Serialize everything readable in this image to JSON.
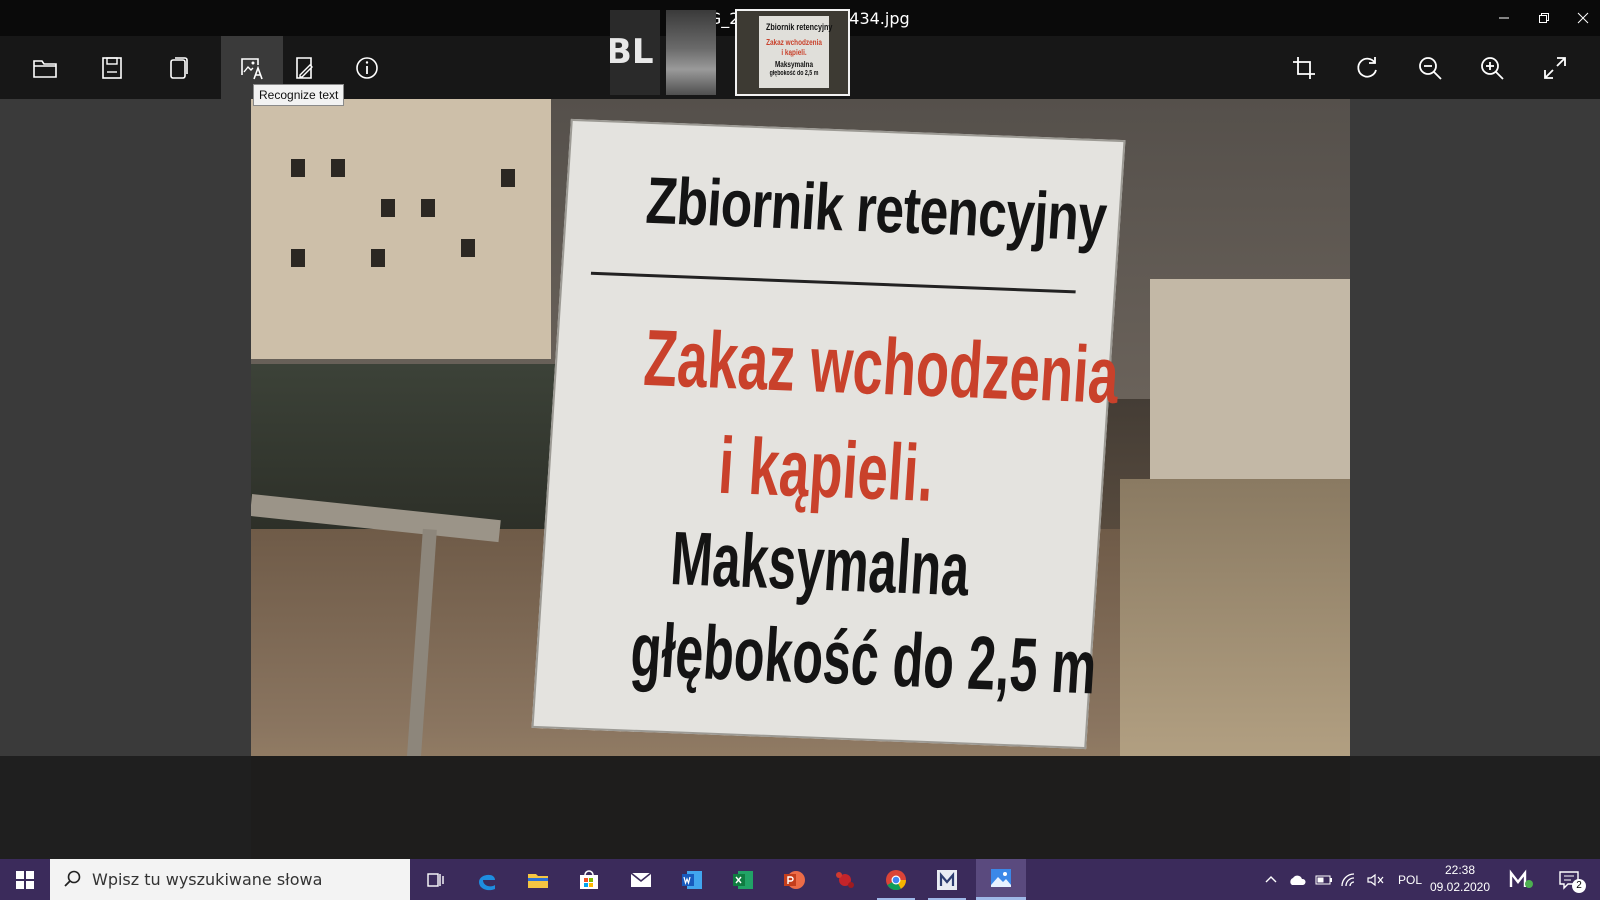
{
  "window": {
    "title": "IMG_20200201_221434.jpg"
  },
  "toolbar": {
    "left_buttons": [
      "folder-open",
      "save",
      "copy",
      "recognize-text",
      "edit-image",
      "info"
    ],
    "right_buttons": [
      "crop",
      "rotate",
      "zoom-out",
      "zoom-in",
      "fullscreen"
    ],
    "tooltip": "Recognize text"
  },
  "photo": {
    "sign_line1": "Zbiornik retencyjny",
    "sign_line2": "Zakaz wchodzenia",
    "sign_line3": "i kąpieli.",
    "sign_line4": "Maksymalna",
    "sign_line5": "głębokość do 2,5 m"
  },
  "filmstrip": {
    "thumb1_text": "BL",
    "thumb3": {
      "line1": "Zbiornik retencyjny",
      "line2": "Zakaz wchodzenia",
      "line3": "i kąpieli.",
      "line4": "Maksymalna",
      "line5": "głębokość do 2,5 m"
    }
  },
  "taskbar": {
    "search_placeholder": "Wpisz tu wyszukiwane słowa",
    "apps": [
      "task-view",
      "edge",
      "file-explorer",
      "store",
      "mail",
      "word",
      "excel",
      "powerpoint",
      "app-red",
      "chrome",
      "app-m",
      "photos"
    ],
    "language": "POL",
    "time": "22:38",
    "date": "09.02.2020",
    "notifications": "2"
  },
  "colors": {
    "accent": "#3b2b5b",
    "sign_red": "#c9412b"
  }
}
